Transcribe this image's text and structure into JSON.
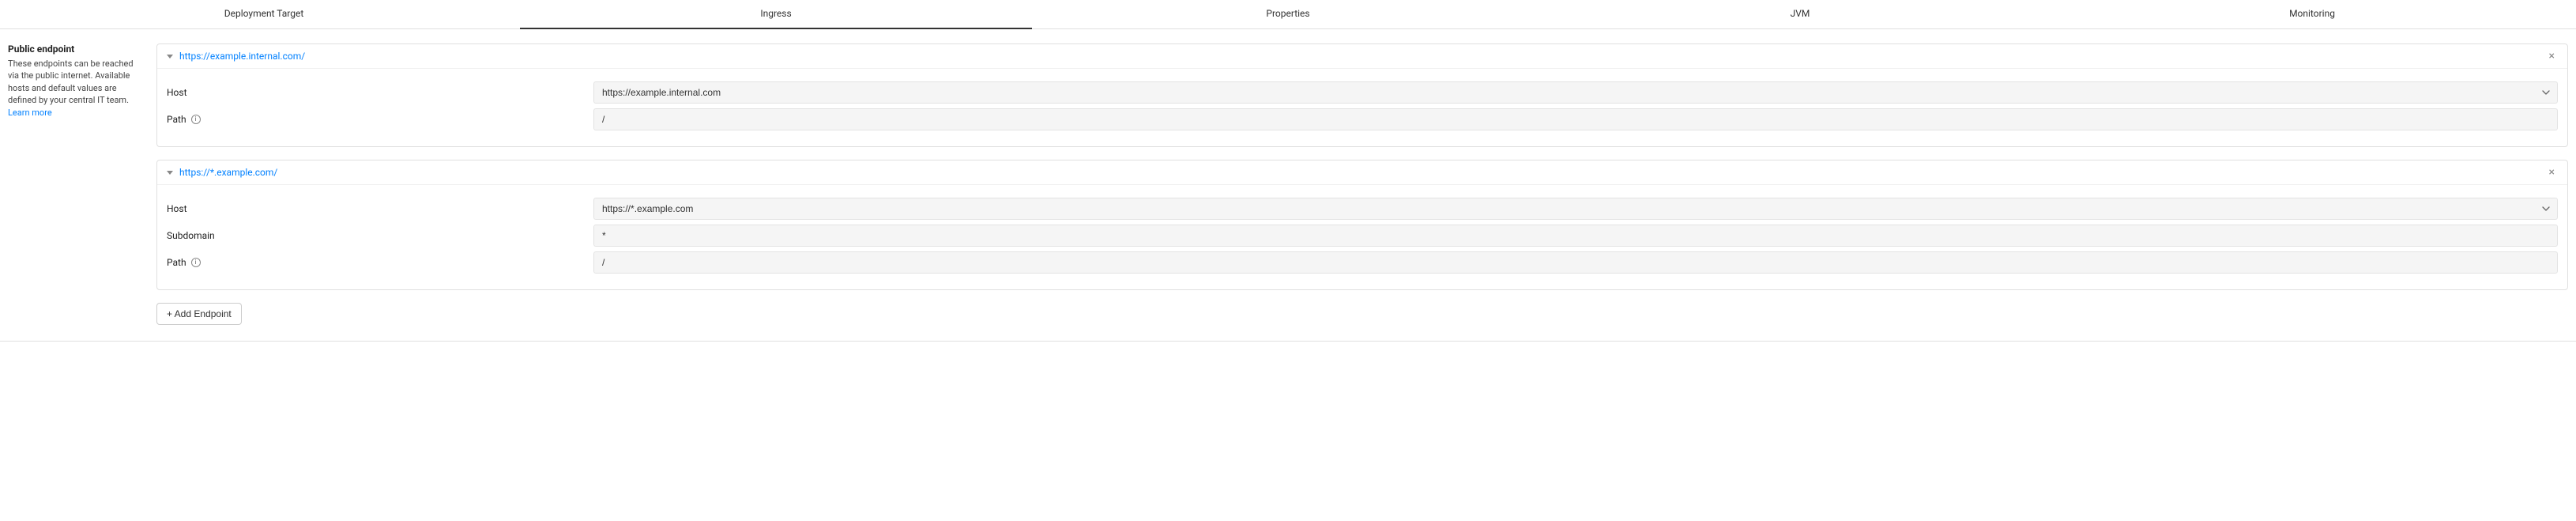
{
  "tabs": {
    "deployment_target": "Deployment Target",
    "ingress": "Ingress",
    "properties": "Properties",
    "jvm": "JVM",
    "monitoring": "Monitoring",
    "active": "ingress"
  },
  "sidebar": {
    "title": "Public endpoint",
    "desc_a": "These endpoints can be reached via the public internet. Available hosts and default values are defined by your central IT team. ",
    "learn_more": "Learn more"
  },
  "labels": {
    "host": "Host",
    "path": "Path",
    "subdomain": "Subdomain"
  },
  "endpoints": [
    {
      "url": "https://example.internal.com/",
      "host": "https://example.internal.com",
      "path": "/",
      "has_subdomain": false
    },
    {
      "url": "https://*.example.com/",
      "host": "https://*.example.com",
      "subdomain": "*",
      "path": "/",
      "has_subdomain": true
    }
  ],
  "buttons": {
    "add_endpoint": "+ Add Endpoint"
  }
}
